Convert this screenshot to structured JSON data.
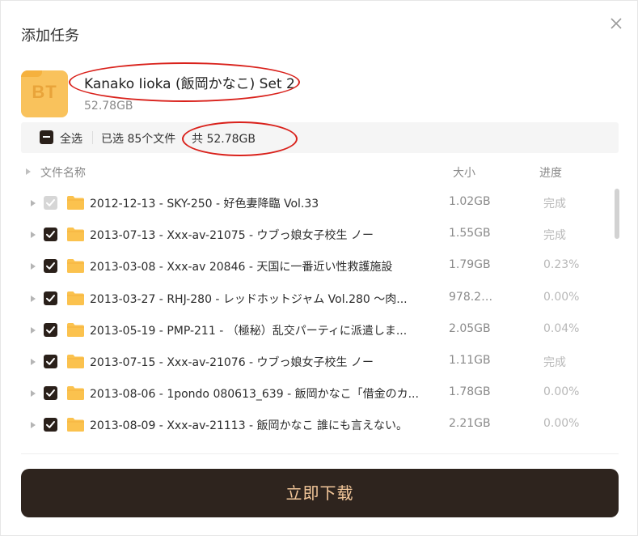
{
  "dialog": {
    "title": "添加任务"
  },
  "task": {
    "icon_label": "BT",
    "name": "Kanako Iioka (飯岡かなこ) Set 2",
    "size": "52.78GB"
  },
  "select_bar": {
    "select_all_label": "全选",
    "selected_count": "已选 85个文件",
    "total": "共 52.78GB"
  },
  "columns": {
    "name": "文件名称",
    "size": "大小",
    "progress": "进度"
  },
  "files": [
    {
      "name": "2012-12-13 - SKY-250 - 好色妻降臨 Vol.33",
      "size": "1.02GB",
      "progress": "完成",
      "checked": true,
      "disabled": true
    },
    {
      "name": "2013-07-13 - Xxx-av-21075 - ウブっ娘女子校生 ノー",
      "size": "1.55GB",
      "progress": "完成",
      "checked": true,
      "disabled": false
    },
    {
      "name": "2013-03-08 - Xxx-av 20846 - 天国に一番近い性救護施設",
      "size": "1.79GB",
      "progress": "0.23%",
      "checked": true,
      "disabled": false
    },
    {
      "name": "2013-03-27 - RHJ-280 - レッドホットジャム Vol.280 ～肉...",
      "size": "978.22...",
      "progress": "0.00%",
      "checked": true,
      "disabled": false
    },
    {
      "name": "2013-05-19 - PMP-211 - （極秘）乱交パーティに派遣しま...",
      "size": "2.05GB",
      "progress": "0.04%",
      "checked": true,
      "disabled": false
    },
    {
      "name": "2013-07-15 - Xxx-av-21076 - ウブっ娘女子校生 ノー",
      "size": "1.11GB",
      "progress": "完成",
      "checked": true,
      "disabled": false
    },
    {
      "name": "2013-08-06 - 1pondo 080613_639 - 飯岡かなこ「借金のカ...",
      "size": "1.78GB",
      "progress": "0.00%",
      "checked": true,
      "disabled": false
    },
    {
      "name": "2013-08-09 - Xxx-av-21113 - 飯岡かなこ 誰にも言えない。",
      "size": "2.21GB",
      "progress": "0.00%",
      "checked": true,
      "disabled": false
    }
  ],
  "download_button": "立即下载",
  "colors": {
    "accent_dark": "#2e241e",
    "button_text": "#f3c79a",
    "folder": "#fbc24e",
    "annotation": "#d9211b"
  },
  "icons": [
    "close-icon",
    "bt-file-icon",
    "folder-icon",
    "checkbox-icon",
    "expand-arrow-icon"
  ]
}
